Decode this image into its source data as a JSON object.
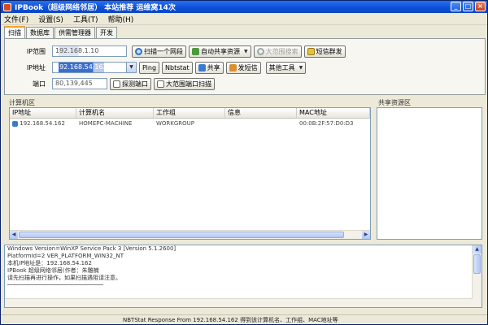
{
  "window": {
    "title": "IPBook（超级网络邻居）  本站推荐  运维窝14次",
    "min": "_",
    "max": "□",
    "close": "×"
  },
  "menu": [
    "文件(F)",
    "设置(S)",
    "工具(T)",
    "帮助(H)"
  ],
  "tabs": [
    "扫描",
    "数据库",
    "供需管理器",
    "开发"
  ],
  "form": {
    "ip_range_label": "IP范围",
    "ip_range_value": "192.168.1.10",
    "scan_segment_button": "扫描一个网段",
    "auto_share_button": "自动共享资源",
    "scan_range_button": "大范围搜索",
    "short_msg_button": "短信群发",
    "ip_addr_label": "IP地址",
    "ip_addr_value": "192.168.54.162",
    "ping_button": "Ping",
    "nbtstat_button": "Nbtstat",
    "share_button": "共享",
    "send_msg_button": "发短信",
    "other_tools_button": "其他工具",
    "port_label": "端口",
    "port_value": "80,139,445",
    "probe_port_button": "探测端口",
    "wide_port_scan_button": "大范围端口扫描"
  },
  "computer_list": {
    "label": "计算机区",
    "columns": [
      "IP地址",
      "计算机名",
      "工作组",
      "信息",
      "MAC地址"
    ],
    "rows": [
      [
        "192.168.54.162",
        "HOMEPC-MACHINE",
        "WORKGROUP",
        "",
        "00:0B:2F:57:D0:D3"
      ]
    ]
  },
  "share_list": {
    "label": "共享资源区"
  },
  "log": {
    "lines": [
      "Windows Version=WinXP Service Pack 3 [Version 5.1.2600]",
      "PlatformId=2 VER_PLATFORM_WIN32_NT",
      "本机IP地址是：192.168.54.162",
      "IPBook 超级网络邻居(作者：朱雕楠",
      "请先扫描再进行操作，如果扫描遇阻请注意。",
      "────────────────────────────"
    ]
  },
  "status": {
    "text": "NBTStat Response From 192.168.54.162 得到该计算机名、工作组、MAC地址等"
  }
}
